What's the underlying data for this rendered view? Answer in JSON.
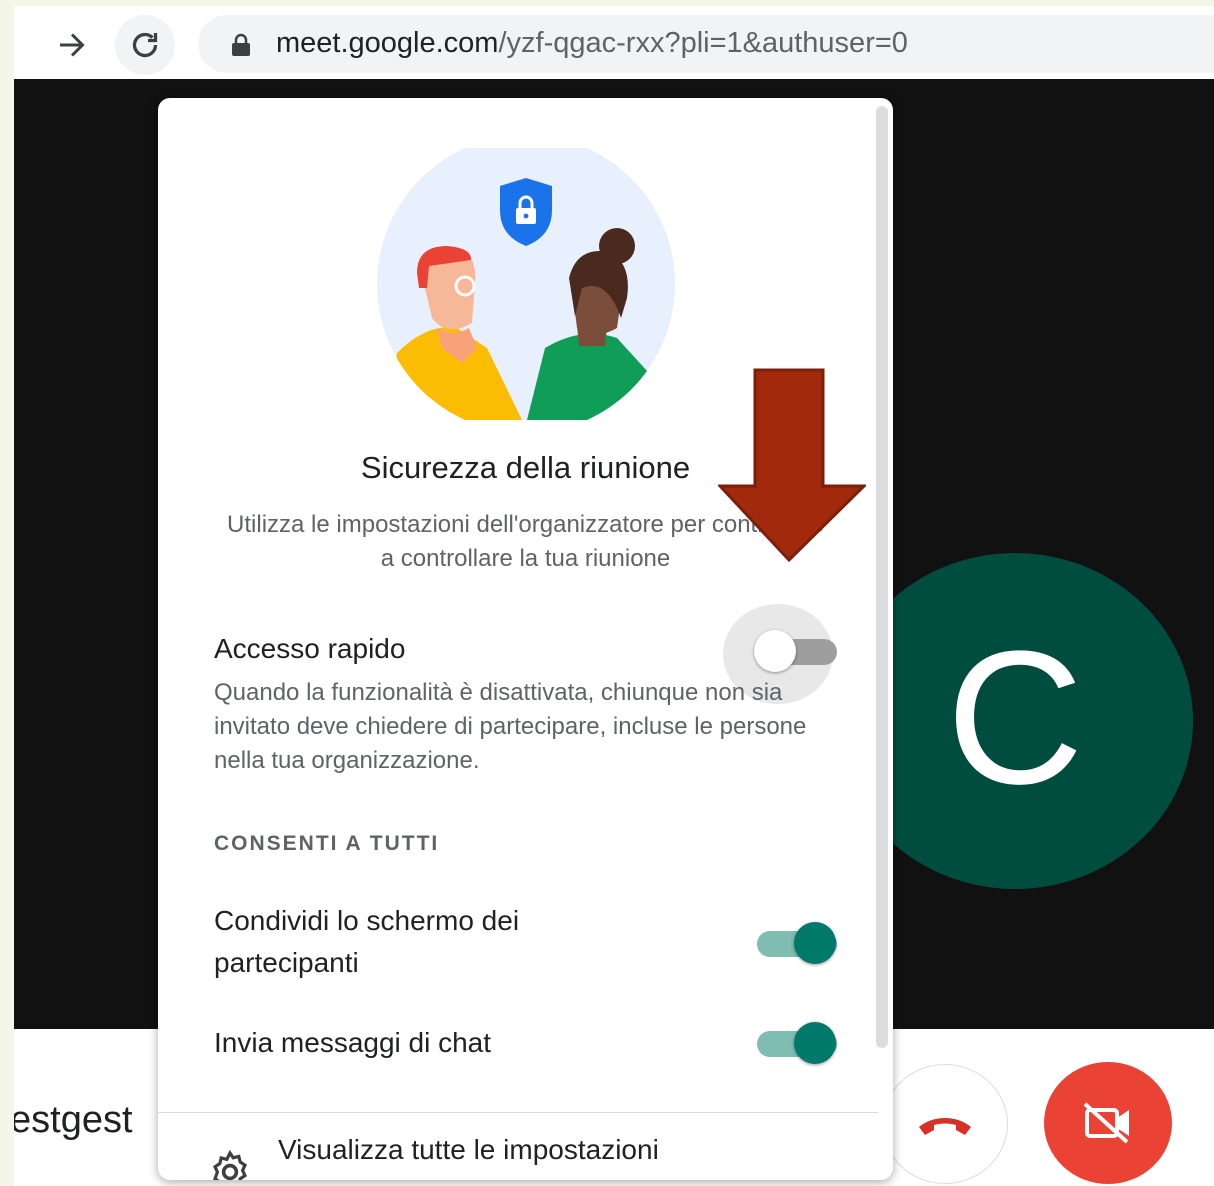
{
  "browser": {
    "url_host": "meet.google.com",
    "url_path": "/yzf-qgac-rxx?pli=1&authuser=0"
  },
  "meeting": {
    "avatar_letter": "C",
    "code_partial": "estgest",
    "avatar_color": "#004d40"
  },
  "dialog": {
    "title": "Sicurezza della riunione",
    "description": "Utilizza le impostazioni dell'organizzatore per continuare a controllare la tua riunione",
    "quick_access": {
      "label": "Accesso rapido",
      "description": "Quando la funzionalità è disattivata, chiunque non sia invitato deve chiedere di partecipare, incluse le persone nella tua organizzazione.",
      "enabled": false
    },
    "section_header": "CONSENTI A TUTTI",
    "share_screen": {
      "label": "Condividi lo schermo dei partecipanti",
      "enabled": true
    },
    "send_chat": {
      "label": "Invia messaggi di chat",
      "enabled": true
    },
    "view_all_label": "Visualizza tutte le impostazioni"
  },
  "colors": {
    "accent": "#00796b",
    "hangup": "#ea4335",
    "annotation_arrow": "#a3290c"
  },
  "icons": [
    "forward-arrow-icon",
    "reload-icon",
    "lock-icon",
    "shield-lock-icon",
    "hangup-icon",
    "camera-off-icon",
    "gear-icon"
  ]
}
